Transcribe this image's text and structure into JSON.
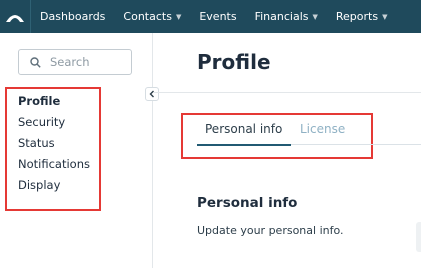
{
  "nav": {
    "items": [
      {
        "label": "Dashboards",
        "has_menu": false
      },
      {
        "label": "Contacts",
        "has_menu": true
      },
      {
        "label": "Events",
        "has_menu": false
      },
      {
        "label": "Financials",
        "has_menu": true
      },
      {
        "label": "Reports",
        "has_menu": true
      }
    ]
  },
  "sidebar": {
    "search_placeholder": "Search",
    "items": [
      {
        "label": "Profile",
        "active": true
      },
      {
        "label": "Security",
        "active": false
      },
      {
        "label": "Status",
        "active": false
      },
      {
        "label": "Notifications",
        "active": false
      },
      {
        "label": "Display",
        "active": false
      }
    ]
  },
  "main": {
    "title": "Profile",
    "tabs": [
      {
        "label": "Personal info",
        "active": true
      },
      {
        "label": "License",
        "active": false
      }
    ],
    "section": {
      "title": "Personal info",
      "description": "Update your personal info."
    }
  },
  "colors": {
    "topbar": "#1f4a5c",
    "annotation_outline": "#e53935",
    "active_tab_underline": "#215a73",
    "inactive_tab_text": "#8fb1c4"
  },
  "icons": {
    "logo": "arch-logo-icon",
    "search": "search-icon",
    "collapse": "chevron-left-icon",
    "menu_caret": "caret-down-icon"
  }
}
